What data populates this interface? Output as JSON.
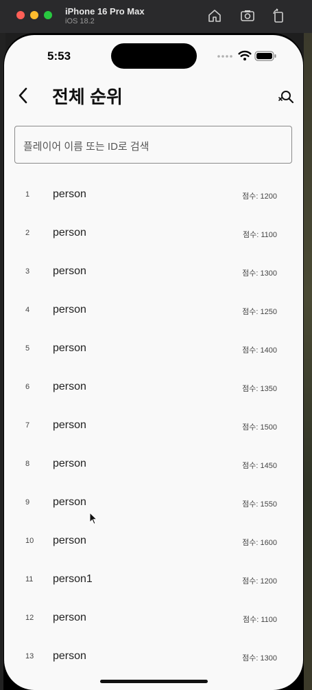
{
  "window": {
    "title": "iPhone 16 Pro Max",
    "subtitle": "iOS 18.2",
    "toolbar_icons": [
      "home-icon",
      "screenshot-icon",
      "rotate-icon"
    ]
  },
  "status_bar": {
    "time": "5:53",
    "icons": [
      "signal-dots-icon",
      "wifi-icon",
      "battery-icon"
    ]
  },
  "app_bar": {
    "title": "전체 순위",
    "back_icon": "back-chevron-icon",
    "search_icon": "search-off-icon"
  },
  "search": {
    "placeholder": "플레이어 이름 또는 ID로 검색"
  },
  "rankings": [
    {
      "rank": "1",
      "name": "person",
      "score": "점수: 1200"
    },
    {
      "rank": "2",
      "name": "person",
      "score": "점수: 1100"
    },
    {
      "rank": "3",
      "name": "person",
      "score": "점수: 1300"
    },
    {
      "rank": "4",
      "name": "person",
      "score": "점수: 1250"
    },
    {
      "rank": "5",
      "name": "person",
      "score": "점수: 1400"
    },
    {
      "rank": "6",
      "name": "person",
      "score": "점수: 1350"
    },
    {
      "rank": "7",
      "name": "person",
      "score": "점수: 1500"
    },
    {
      "rank": "8",
      "name": "person",
      "score": "점수: 1450"
    },
    {
      "rank": "9",
      "name": "person",
      "score": "점수: 1550"
    },
    {
      "rank": "10",
      "name": "person",
      "score": "점수: 1600"
    },
    {
      "rank": "11",
      "name": "person1",
      "score": "점수: 1200"
    },
    {
      "rank": "12",
      "name": "person",
      "score": "점수: 1100"
    },
    {
      "rank": "13",
      "name": "person",
      "score": "점수: 1300"
    }
  ],
  "colors": {
    "screen_background": "#f9f9f9",
    "text_primary": "#111111",
    "search_border": "#8a8a8a"
  }
}
